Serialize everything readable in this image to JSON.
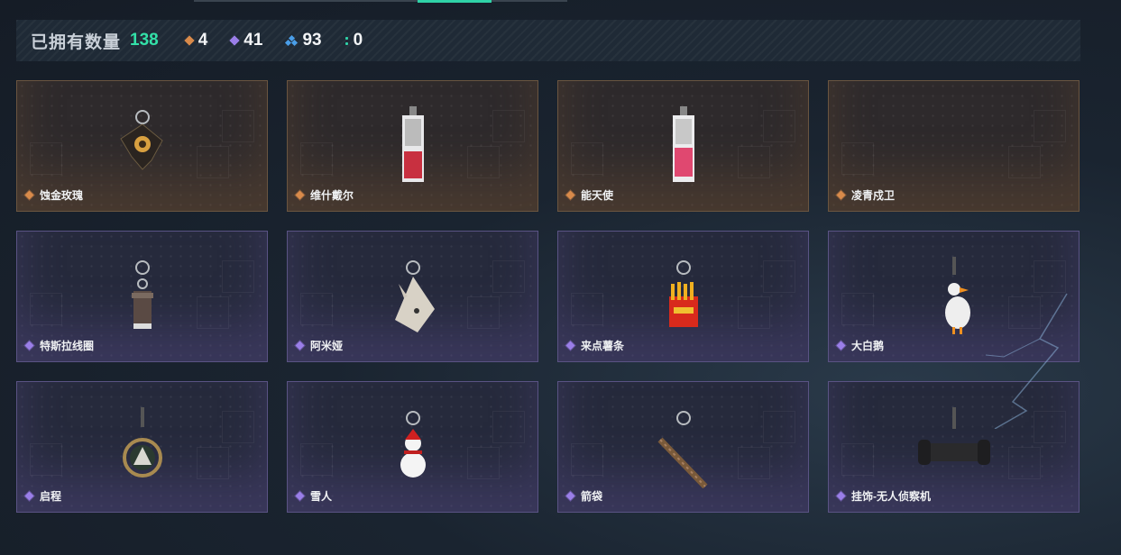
{
  "stats": {
    "label": "已拥有数量",
    "total": "138",
    "counts": [
      {
        "icon": "orange-diamond-icon",
        "value": "4",
        "color": "#d88a4a"
      },
      {
        "icon": "purple-diamond-icon",
        "value": "41",
        "color": "#9a7ee8"
      },
      {
        "icon": "blue-triangle-icon",
        "value": "93",
        "color": "#4a9ee8"
      },
      {
        "icon": "green-dots-icon",
        "value": "0",
        "color": "#2fd3a8"
      }
    ]
  },
  "items": [
    {
      "name": "蚀金玫瑰",
      "rarity": "orange",
      "art": "rose"
    },
    {
      "name": "维什戴尔",
      "rarity": "orange",
      "art": "card"
    },
    {
      "name": "能天使",
      "rarity": "orange",
      "art": "card2"
    },
    {
      "name": "凌青戍卫",
      "rarity": "orange",
      "art": "none"
    },
    {
      "name": "特斯拉线圈",
      "rarity": "purple",
      "art": "coil"
    },
    {
      "name": "阿米娅",
      "rarity": "purple",
      "art": "bunny"
    },
    {
      "name": "来点薯条",
      "rarity": "purple",
      "art": "fries"
    },
    {
      "name": "大白鹅",
      "rarity": "purple",
      "art": "goose"
    },
    {
      "name": "启程",
      "rarity": "purple",
      "art": "medal"
    },
    {
      "name": "雪人",
      "rarity": "purple",
      "art": "snowman"
    },
    {
      "name": "箭袋",
      "rarity": "purple",
      "art": "quiver"
    },
    {
      "name": "挂饰-无人侦察机",
      "rarity": "purple",
      "art": "drone"
    }
  ],
  "colors": {
    "accent": "#2fd3a8",
    "orange": "#d88a4a",
    "purple": "#9a7ee8"
  }
}
